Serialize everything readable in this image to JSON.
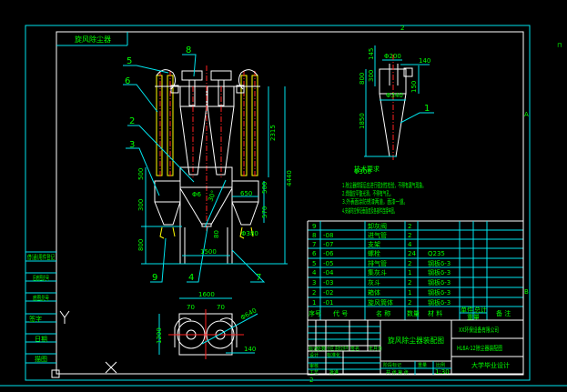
{
  "drawing": {
    "frame_title": "旋风除尘器",
    "zone_labels": {
      "top": "2",
      "bottom": "2",
      "right_a": "A",
      "right_b": "B",
      "corner": "⊓"
    },
    "callouts": [
      "1",
      "2",
      "3",
      "4",
      "5",
      "6",
      "7",
      "8",
      "9"
    ],
    "front_view_dims": [
      "4440",
      "2315",
      "500",
      "300",
      "800",
      "650",
      "500",
      "570",
      "1500",
      "80",
      "Φ6",
      "30°",
      "Φ380"
    ],
    "plan_view_dims": [
      "1600",
      "70",
      "70",
      "1200",
      "Φ640",
      "140"
    ],
    "side_view_dims": [
      "Φ200",
      "140",
      "145",
      "800",
      "300",
      "150",
      "Φ340",
      "1850"
    ],
    "side_view_caption": "Φ300",
    "notes_title": "技术要求",
    "notes": [
      "1.除尘器焊接后应进行密封性检验，不得有漏气现象。",
      "2.焊缝应平整光滑，不得有气孔。",
      "3.外表面涂防锈漆两道，面漆一道。",
      "4.安装时应保证垂直度及各部件连接牢固。"
    ],
    "colors": {
      "frame": "#00e5ee",
      "geometry": "#ffffff",
      "text": "#00ff00",
      "centerline": "#ff2020",
      "bag": "#ffff00"
    }
  },
  "left_column": [
    "借(通)用件登记",
    "旧底图总号",
    "底图总号",
    "签字",
    "日期",
    "描图"
  ],
  "parts_list": {
    "rows": [
      {
        "no": "9",
        "code": "",
        "name": "卸灰阀",
        "qty": "2",
        "material": ""
      },
      {
        "no": "8",
        "code": "-08",
        "name": "进气管",
        "qty": "2",
        "material": ""
      },
      {
        "no": "7",
        "code": "-07",
        "name": "支架",
        "qty": "4",
        "material": ""
      },
      {
        "no": "6",
        "code": "-06",
        "name": "螺栓",
        "qty": "24",
        "material": "Q235"
      },
      {
        "no": "5",
        "code": "-05",
        "name": "排气管",
        "qty": "2",
        "material": "钢板δ-3"
      },
      {
        "no": "4",
        "code": "-04",
        "name": "集灰斗",
        "qty": "1",
        "material": "钢板δ-3"
      },
      {
        "no": "3",
        "code": "-03",
        "name": "灰斗",
        "qty": "2",
        "material": "钢板δ-3"
      },
      {
        "no": "2",
        "code": "-02",
        "name": "箱体",
        "qty": "1",
        "material": "钢板δ-3"
      },
      {
        "no": "1",
        "code": "-01",
        "name": "旋风筒体",
        "qty": "2",
        "material": "钢板δ-3"
      }
    ],
    "header": {
      "no": "序号",
      "code": "代 号",
      "name": "名 称",
      "qty": "数量",
      "material": "材 料",
      "unit_weight": "单件",
      "total_weight": "总计",
      "weight": "重量",
      "remark": "备 注"
    }
  },
  "title_block": {
    "revision_headers": [
      "标记",
      "处数",
      "分区",
      "更改文件号",
      "签名",
      "年月日"
    ],
    "signatures": [
      "设计",
      "标准化",
      "审核",
      "工艺",
      "批准"
    ],
    "drawing_name": "旋风除尘器装配图",
    "stage_label": "阶段标记",
    "weight_label": "重量",
    "scale_label": "比例",
    "scale": "1:30",
    "sheet_label": "共 张 第 张",
    "company": "XX环保设备有限公司",
    "drawing_no": "HL6A-12除尘器装配图",
    "school": "大学毕业设计"
  }
}
